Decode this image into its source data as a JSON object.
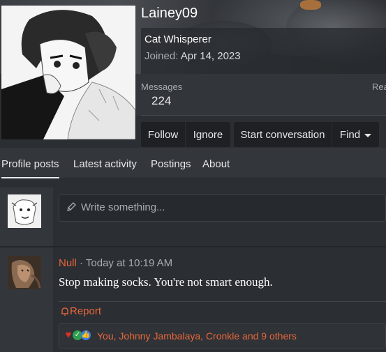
{
  "profile": {
    "username": "Lainey09",
    "user_title": "Cat Whisperer",
    "joined_label": "Joined:",
    "joined_date": "Apr 14, 2023"
  },
  "stats": {
    "messages_label": "Messages",
    "messages_value": "224",
    "second_label_partial": "Rea"
  },
  "actions": {
    "follow": "Follow",
    "ignore": "Ignore",
    "start_conversation": "Start conversation",
    "find": "Find"
  },
  "tabs": [
    {
      "label": "Profile posts",
      "active": true
    },
    {
      "label": "Latest activity",
      "active": false
    },
    {
      "label": "Postings",
      "active": false
    },
    {
      "label": "About",
      "active": false
    }
  ],
  "composer": {
    "placeholder": "Write something..."
  },
  "post": {
    "author": "Null",
    "separator": " · ",
    "timestamp": "Today at 10:19 AM",
    "body": "Stop making socks. You're not smart enough.",
    "report_label": "Report",
    "reactions_text": "You, Johnny Jambalaya, Cronkle and 9 others"
  },
  "colors": {
    "accent": "#e8673a",
    "background": "#2b2e33",
    "button": "#1e2024"
  }
}
